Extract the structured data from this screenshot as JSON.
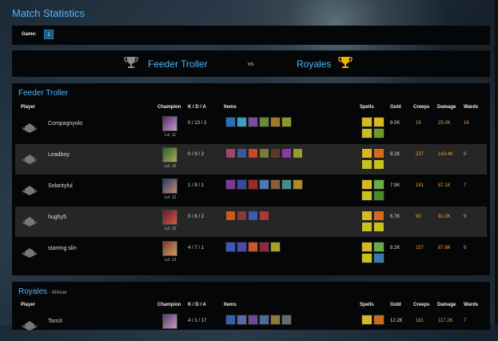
{
  "page_title": "Match Statistics",
  "game": {
    "label": "Game:",
    "selected": "1"
  },
  "versus": {
    "team_a": "Feeder Troller",
    "vs": "vs",
    "team_b": "Royales"
  },
  "headers": {
    "player": "Player",
    "champion": "Champion",
    "kda": "K / D / A",
    "items": "Items",
    "spells": "Spells",
    "gold": "Gold",
    "creeps": "Creeps",
    "damage": "Damage",
    "wards": "Wards"
  },
  "colors": {
    "accent": "#4fb8ff",
    "stat": "#f39c3c",
    "panel": "#050607",
    "row_alt": "#262626"
  },
  "teams": [
    {
      "name": "Feeder Troller",
      "subtitle": "",
      "players": [
        {
          "name": "Compagnyolo",
          "level": "Lvl. 11",
          "kda": "0 / 13 / 2",
          "gold": "6.0K",
          "creeps": "19",
          "damage": "25.0K",
          "wards": "16"
        },
        {
          "name": "Leadboy",
          "level": "Lvl. 15",
          "kda": "0 / 9 / 3",
          "gold": "9.2K",
          "creeps": "237",
          "damage": "143.4K",
          "wards": "9"
        },
        {
          "name": "Solarityful",
          "level": "Lvl. 12",
          "kda": "1 / 9 / 1",
          "gold": "7.9K",
          "creeps": "181",
          "damage": "87.1K",
          "wards": "7"
        },
        {
          "name": "hughy5",
          "level": "Lvl. 12",
          "kda": "0 / 6 / 2",
          "gold": "6.7K",
          "creeps": "90",
          "damage": "91.0K",
          "wards": "9"
        },
        {
          "name": "starring slin",
          "level": "Lvl. 13",
          "kda": "4 / 7 / 1",
          "gold": "8.2K",
          "creeps": "157",
          "damage": "87.8K",
          "wards": "9"
        }
      ]
    },
    {
      "name": "Royales",
      "subtitle": "- Winner",
      "players": [
        {
          "name": "TornX",
          "level": "",
          "kda": "4 / 1 / 17",
          "gold": "12.2K",
          "creeps": "181",
          "damage": "117.2K",
          "wards": "7"
        }
      ]
    }
  ]
}
